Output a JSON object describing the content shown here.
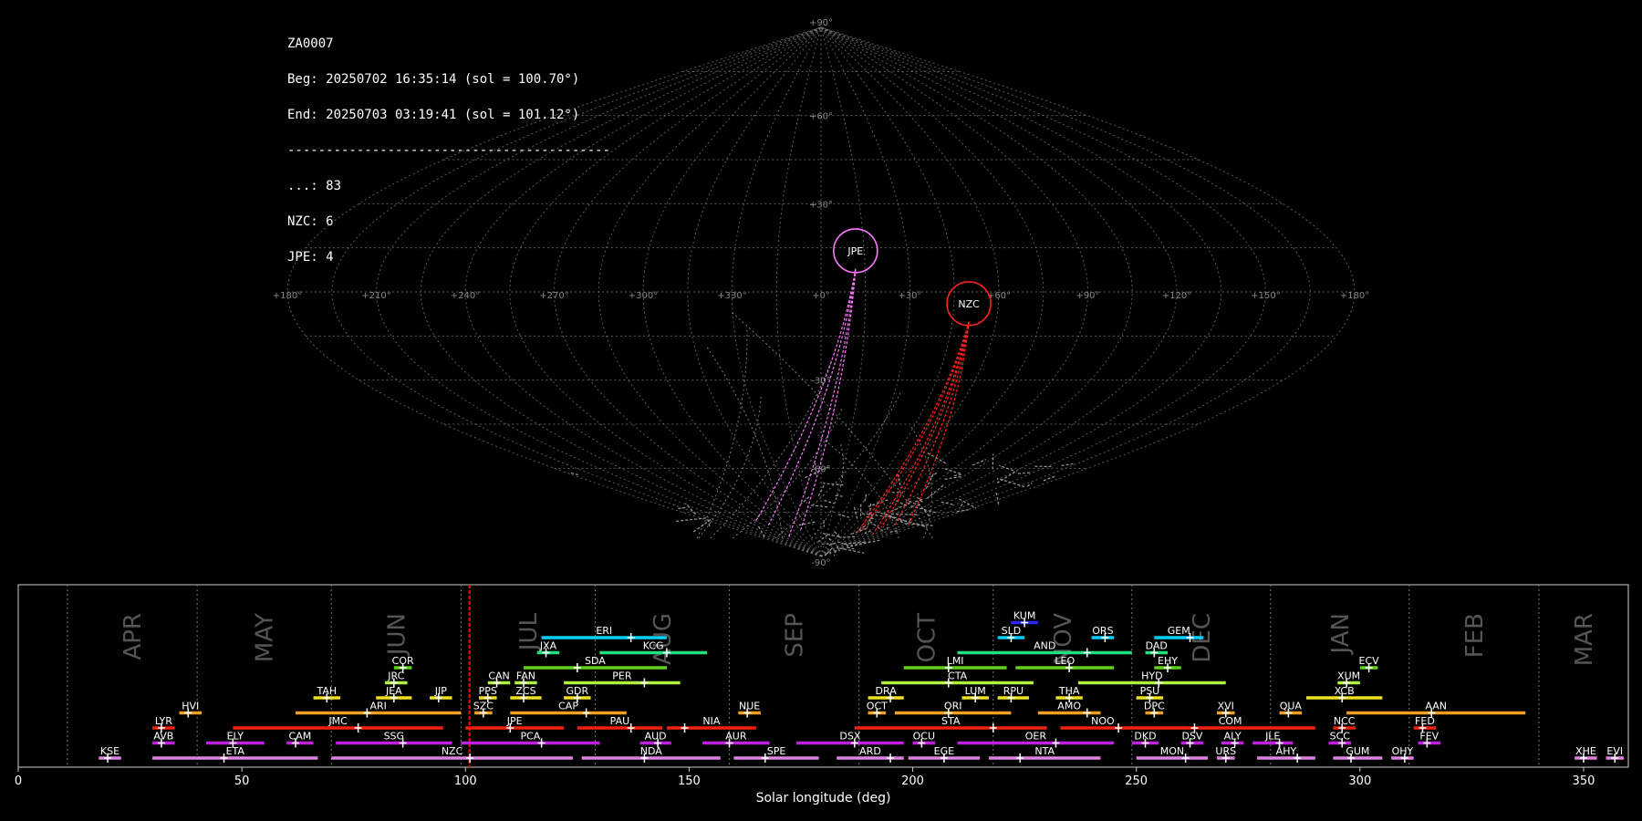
{
  "info": {
    "id": "ZA0007",
    "beg": "Beg: 20250702 16:35:14 (sol = 100.70°)",
    "end": "End: 20250703 03:19:41 (sol = 101.12°)",
    "sep": "------------------------------------------",
    "counts": [
      "...: 83",
      "NZC: 6",
      "JPE: 4"
    ]
  },
  "chart_data": [
    {
      "type": "scatter",
      "projection": "sinusoidal",
      "lon_labels": [
        "+180°",
        "+150°",
        "+120°",
        "+90°",
        "+60°",
        "+30°",
        "+0°",
        "+330°",
        "+300°",
        "+270°",
        "+240°",
        "+210°",
        "+180°"
      ],
      "lat_labels": [
        {
          "lat": 90,
          "text": "+90°"
        },
        {
          "lat": 60,
          "text": "+60°"
        },
        {
          "lat": 30,
          "text": "+30°"
        },
        {
          "lat": -30,
          "text": "-30°"
        },
        {
          "lat": -60,
          "text": "-60°"
        },
        {
          "lat": -90,
          "text": "-90°"
        }
      ],
      "radiants": [
        {
          "name": "JPE",
          "lon": 348,
          "lat": 14,
          "color": "#ff77ff"
        },
        {
          "name": "NZC",
          "lon": 310,
          "lat": -4,
          "color": "#ff2020"
        }
      ],
      "colors": {
        "sporadic": "#9a9a9a",
        "grid": "#7a7a7a"
      }
    },
    {
      "type": "bar",
      "orientation": "horizontal-ranges",
      "xlabel": "Solar longitude (deg)",
      "xlim": [
        0,
        360
      ],
      "xticks": [
        0,
        50,
        100,
        150,
        200,
        250,
        300,
        350
      ],
      "current_sol": 100.9,
      "months": [
        {
          "name": "APR",
          "start": 11,
          "end": 40
        },
        {
          "name": "MAY",
          "start": 40,
          "end": 70
        },
        {
          "name": "JUN",
          "start": 70,
          "end": 99
        },
        {
          "name": "JUL",
          "start": 99,
          "end": 129
        },
        {
          "name": "AUG",
          "start": 129,
          "end": 159
        },
        {
          "name": "SEP",
          "start": 159,
          "end": 188
        },
        {
          "name": "OCT",
          "start": 188,
          "end": 218
        },
        {
          "name": "NOV",
          "start": 218,
          "end": 249
        },
        {
          "name": "DEC",
          "start": 249,
          "end": 280
        },
        {
          "name": "JAN",
          "start": 280,
          "end": 311
        },
        {
          "name": "FEB",
          "start": 311,
          "end": 340
        },
        {
          "name": "MAR",
          "start": 340,
          "end": 370
        }
      ],
      "showers": [
        {
          "name": "KUM",
          "start": 222,
          "end": 228,
          "peak": 225,
          "row": 9,
          "color": "#2828ff"
        },
        {
          "name": "ERI",
          "start": 117,
          "end": 145,
          "peak": 137,
          "row": 8,
          "color": "#00d0ff"
        },
        {
          "name": "SLD",
          "start": 219,
          "end": 225,
          "peak": 222,
          "row": 8,
          "color": "#00d0ff"
        },
        {
          "name": "ORS",
          "start": 240,
          "end": 245,
          "peak": 243,
          "row": 8,
          "color": "#00d0ff"
        },
        {
          "name": "GEM",
          "start": 254,
          "end": 265,
          "peak": 262,
          "row": 8,
          "color": "#00d0ff"
        },
        {
          "name": "JXA",
          "start": 116,
          "end": 121,
          "peak": 118,
          "row": 7,
          "color": "#20e080"
        },
        {
          "name": "KCG",
          "start": 130,
          "end": 154,
          "peak": 145,
          "row": 7,
          "color": "#20e080"
        },
        {
          "name": "AND",
          "start": 210,
          "end": 249,
          "peak": 239,
          "row": 7,
          "color": "#20e080"
        },
        {
          "name": "DAD",
          "start": 252,
          "end": 257,
          "peak": 254,
          "row": 7,
          "color": "#20e080"
        },
        {
          "name": "COR",
          "start": 84,
          "end": 88,
          "peak": 86,
          "row": 6,
          "color": "#60d020"
        },
        {
          "name": "SDA",
          "start": 113,
          "end": 145,
          "peak": 125,
          "row": 6,
          "color": "#60d020"
        },
        {
          "name": "LMI",
          "start": 198,
          "end": 221,
          "peak": 208,
          "row": 6,
          "color": "#60d020"
        },
        {
          "name": "LEO",
          "start": 223,
          "end": 245,
          "peak": 235,
          "row": 6,
          "color": "#60d020"
        },
        {
          "name": "EHY",
          "start": 254,
          "end": 260,
          "peak": 257,
          "row": 6,
          "color": "#60d020"
        },
        {
          "name": "ECV",
          "start": 300,
          "end": 304,
          "peak": 302,
          "row": 6,
          "color": "#60d020"
        },
        {
          "name": "JRC",
          "start": 82,
          "end": 87,
          "peak": 84,
          "row": 5,
          "color": "#b0f040"
        },
        {
          "name": "CAN",
          "start": 105,
          "end": 110,
          "peak": 107,
          "row": 5,
          "color": "#b0f040"
        },
        {
          "name": "FAN",
          "start": 111,
          "end": 116,
          "peak": 113,
          "row": 5,
          "color": "#b0f040"
        },
        {
          "name": "PER",
          "start": 122,
          "end": 148,
          "peak": 140,
          "row": 5,
          "color": "#b0f040"
        },
        {
          "name": "CTA",
          "start": 193,
          "end": 227,
          "peak": 208,
          "row": 5,
          "color": "#b0f040"
        },
        {
          "name": "HYD",
          "start": 237,
          "end": 270,
          "peak": 255,
          "row": 5,
          "color": "#b0f040"
        },
        {
          "name": "XUM",
          "start": 295,
          "end": 300,
          "peak": 297,
          "row": 5,
          "color": "#b0f040"
        },
        {
          "name": "TAH",
          "start": 66,
          "end": 72,
          "peak": 69,
          "row": 4,
          "color": "#f0e020"
        },
        {
          "name": "JEA",
          "start": 80,
          "end": 88,
          "peak": 84,
          "row": 4,
          "color": "#f0e020"
        },
        {
          "name": "JIP",
          "start": 92,
          "end": 97,
          "peak": 94,
          "row": 4,
          "color": "#f0e020"
        },
        {
          "name": "PPS",
          "start": 103,
          "end": 107,
          "peak": 105,
          "row": 4,
          "color": "#f0e020"
        },
        {
          "name": "ZCS",
          "start": 110,
          "end": 117,
          "peak": 113,
          "row": 4,
          "color": "#f0e020"
        },
        {
          "name": "GDR",
          "start": 122,
          "end": 128,
          "peak": 125,
          "row": 4,
          "color": "#f0e020"
        },
        {
          "name": "DRA",
          "start": 190,
          "end": 198,
          "peak": 195,
          "row": 4,
          "color": "#f0e020"
        },
        {
          "name": "LUM",
          "start": 211,
          "end": 217,
          "peak": 214,
          "row": 4,
          "color": "#f0e020"
        },
        {
          "name": "RPU",
          "start": 219,
          "end": 226,
          "peak": 222,
          "row": 4,
          "color": "#f0e020"
        },
        {
          "name": "THA",
          "start": 232,
          "end": 238,
          "peak": 235,
          "row": 4,
          "color": "#f0e020"
        },
        {
          "name": "PSU",
          "start": 250,
          "end": 256,
          "peak": 253,
          "row": 4,
          "color": "#f0e020"
        },
        {
          "name": "XCB",
          "start": 288,
          "end": 305,
          "peak": 296,
          "row": 4,
          "color": "#f0e020"
        },
        {
          "name": "HVI",
          "start": 36,
          "end": 41,
          "peak": 38,
          "row": 3,
          "color": "#f0a020"
        },
        {
          "name": "ARI",
          "start": 62,
          "end": 99,
          "peak": 78,
          "row": 3,
          "color": "#f0a020"
        },
        {
          "name": "SZC",
          "start": 102,
          "end": 106,
          "peak": 104,
          "row": 3,
          "color": "#f0a020"
        },
        {
          "name": "CAP",
          "start": 110,
          "end": 136,
          "peak": 127,
          "row": 3,
          "color": "#f0a020"
        },
        {
          "name": "NUE",
          "start": 161,
          "end": 166,
          "peak": 163,
          "row": 3,
          "color": "#f0a020"
        },
        {
          "name": "OCT",
          "start": 190,
          "end": 194,
          "peak": 192,
          "row": 3,
          "color": "#f0a020"
        },
        {
          "name": "ORI",
          "start": 196,
          "end": 222,
          "peak": 208,
          "row": 3,
          "color": "#f0a020"
        },
        {
          "name": "AMO",
          "start": 228,
          "end": 242,
          "peak": 239,
          "row": 3,
          "color": "#f0a020"
        },
        {
          "name": "DPC",
          "start": 252,
          "end": 256,
          "peak": 254,
          "row": 3,
          "color": "#f0a020"
        },
        {
          "name": "XVI",
          "start": 268,
          "end": 272,
          "peak": 270,
          "row": 3,
          "color": "#f0a020"
        },
        {
          "name": "QUA",
          "start": 282,
          "end": 287,
          "peak": 284,
          "row": 3,
          "color": "#f0a020"
        },
        {
          "name": "AAN",
          "start": 297,
          "end": 337,
          "peak": 316,
          "row": 3,
          "color": "#f0a020"
        },
        {
          "name": "LYR",
          "start": 30,
          "end": 35,
          "peak": 32,
          "row": 2,
          "color": "#f02010"
        },
        {
          "name": "JMC",
          "start": 48,
          "end": 95,
          "peak": 76,
          "row": 2,
          "color": "#f02010"
        },
        {
          "name": "JPE",
          "start": 100,
          "end": 122,
          "peak": 110,
          "row": 2,
          "color": "#f02010"
        },
        {
          "name": "PAU",
          "start": 125,
          "end": 144,
          "peak": 137,
          "row": 2,
          "color": "#f02010"
        },
        {
          "name": "NIA",
          "start": 145,
          "end": 165,
          "peak": 149,
          "row": 2,
          "color": "#f02010"
        },
        {
          "name": "STA",
          "start": 187,
          "end": 230,
          "peak": 218,
          "row": 2,
          "color": "#f02010"
        },
        {
          "name": "NOO",
          "start": 233,
          "end": 252,
          "peak": 246,
          "row": 2,
          "color": "#f02010"
        },
        {
          "name": "COM",
          "start": 252,
          "end": 290,
          "peak": 263,
          "row": 2,
          "color": "#f02010"
        },
        {
          "name": "NCC",
          "start": 294,
          "end": 299,
          "peak": 296,
          "row": 2,
          "color": "#f02010"
        },
        {
          "name": "FED",
          "start": 312,
          "end": 317,
          "peak": 314,
          "row": 2,
          "color": "#f02010"
        },
        {
          "name": "AVB",
          "start": 30,
          "end": 35,
          "peak": 32,
          "row": 1,
          "color": "#c020e0"
        },
        {
          "name": "ELY",
          "start": 42,
          "end": 55,
          "peak": 48,
          "row": 1,
          "color": "#c020e0"
        },
        {
          "name": "CAM",
          "start": 60,
          "end": 66,
          "peak": 62,
          "row": 1,
          "color": "#c020e0"
        },
        {
          "name": "SSG",
          "start": 71,
          "end": 97,
          "peak": 86,
          "row": 1,
          "color": "#c020e0"
        },
        {
          "name": "PCA",
          "start": 99,
          "end": 130,
          "peak": 117,
          "row": 1,
          "color": "#c020e0"
        },
        {
          "name": "AUD",
          "start": 139,
          "end": 146,
          "peak": 143,
          "row": 1,
          "color": "#c020e0"
        },
        {
          "name": "AUR",
          "start": 153,
          "end": 168,
          "peak": 159,
          "row": 1,
          "color": "#c020e0"
        },
        {
          "name": "DSX",
          "start": 174,
          "end": 198,
          "peak": 187,
          "row": 1,
          "color": "#c020e0"
        },
        {
          "name": "OCU",
          "start": 200,
          "end": 205,
          "peak": 202,
          "row": 1,
          "color": "#c020e0"
        },
        {
          "name": "OER",
          "start": 210,
          "end": 245,
          "peak": 232,
          "row": 1,
          "color": "#c020e0"
        },
        {
          "name": "DKD",
          "start": 249,
          "end": 255,
          "peak": 252,
          "row": 1,
          "color": "#c020e0"
        },
        {
          "name": "DSV",
          "start": 260,
          "end": 265,
          "peak": 262,
          "row": 1,
          "color": "#c020e0"
        },
        {
          "name": "ALY",
          "start": 269,
          "end": 274,
          "peak": 272,
          "row": 1,
          "color": "#c020e0"
        },
        {
          "name": "JLE",
          "start": 276,
          "end": 285,
          "peak": 282,
          "row": 1,
          "color": "#c020e0"
        },
        {
          "name": "SCC",
          "start": 293,
          "end": 298,
          "peak": 296,
          "row": 1,
          "color": "#c020e0"
        },
        {
          "name": "FEV",
          "start": 313,
          "end": 318,
          "peak": 315,
          "row": 1,
          "color": "#c020e0"
        },
        {
          "name": "KSE",
          "start": 18,
          "end": 23,
          "peak": 20,
          "row": 0,
          "color": "#e080e0"
        },
        {
          "name": "ETA",
          "start": 30,
          "end": 67,
          "peak": 46,
          "row": 0,
          "color": "#e080e0"
        },
        {
          "name": "NZC",
          "start": 70,
          "end": 124,
          "peak": 101,
          "row": 0,
          "color": "#e080e0"
        },
        {
          "name": "NDA",
          "start": 126,
          "end": 157,
          "peak": 140,
          "row": 0,
          "color": "#e080e0"
        },
        {
          "name": "SPE",
          "start": 160,
          "end": 179,
          "peak": 167,
          "row": 0,
          "color": "#e080e0"
        },
        {
          "name": "ARD",
          "start": 183,
          "end": 198,
          "peak": 195,
          "row": 0,
          "color": "#e080e0"
        },
        {
          "name": "EGE",
          "start": 199,
          "end": 215,
          "peak": 207,
          "row": 0,
          "color": "#e080e0"
        },
        {
          "name": "NTA",
          "start": 217,
          "end": 242,
          "peak": 224,
          "row": 0,
          "color": "#e080e0"
        },
        {
          "name": "MON",
          "start": 250,
          "end": 266,
          "peak": 261,
          "row": 0,
          "color": "#e080e0"
        },
        {
          "name": "URS",
          "start": 268,
          "end": 272,
          "peak": 270,
          "row": 0,
          "color": "#e080e0"
        },
        {
          "name": "AHY",
          "start": 277,
          "end": 290,
          "peak": 286,
          "row": 0,
          "color": "#e080e0"
        },
        {
          "name": "GUM",
          "start": 294,
          "end": 305,
          "peak": 298,
          "row": 0,
          "color": "#e080e0"
        },
        {
          "name": "OHY",
          "start": 307,
          "end": 312,
          "peak": 310,
          "row": 0,
          "color": "#e080e0"
        },
        {
          "name": "XHE",
          "start": 348,
          "end": 353,
          "peak": 350,
          "row": 0,
          "color": "#e080e0"
        },
        {
          "name": "EVI",
          "start": 355,
          "end": 359,
          "peak": 357,
          "row": 0,
          "color": "#e080e0"
        }
      ]
    }
  ]
}
